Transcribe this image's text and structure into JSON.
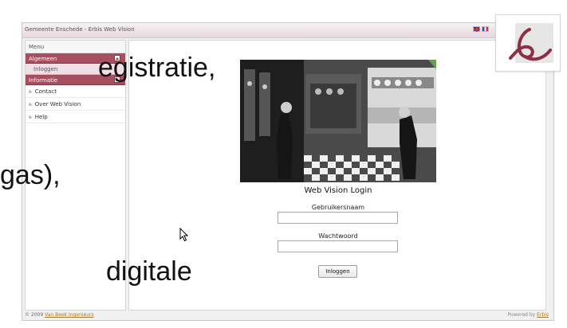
{
  "window": {
    "title": "Gemeente Enschede - Erbis Web Vision",
    "flags": [
      "english-flag",
      "french-flag"
    ]
  },
  "sidebar": {
    "menu_label": "Menu",
    "categories": [
      {
        "label": "Algemeen",
        "items": [
          "Inloggen"
        ]
      },
      {
        "label": "Informatie",
        "items": []
      }
    ],
    "links": [
      "Contact",
      "Over Web Vision",
      "Help"
    ]
  },
  "login": {
    "title": "Web Vision Login",
    "username_label": "Gebruikersnaam",
    "username_value": "",
    "password_label": "Wachtwoord",
    "password_value": "",
    "button_label": "Inloggen"
  },
  "footer": {
    "copyright_prefix": "© 2009",
    "company_link": "Van Beek Ingenieurs",
    "powered_prefix": "Powered by",
    "powered_link": "Erbis"
  },
  "overlay": {
    "line1": "egistratie,",
    "line2": "gas),",
    "line3": "digitale"
  },
  "colors": {
    "accent": "#a84f5f",
    "sub_item_bg": "#f1dfe5",
    "link": "#a6782a",
    "logo_stroke": "#8e2f45"
  }
}
